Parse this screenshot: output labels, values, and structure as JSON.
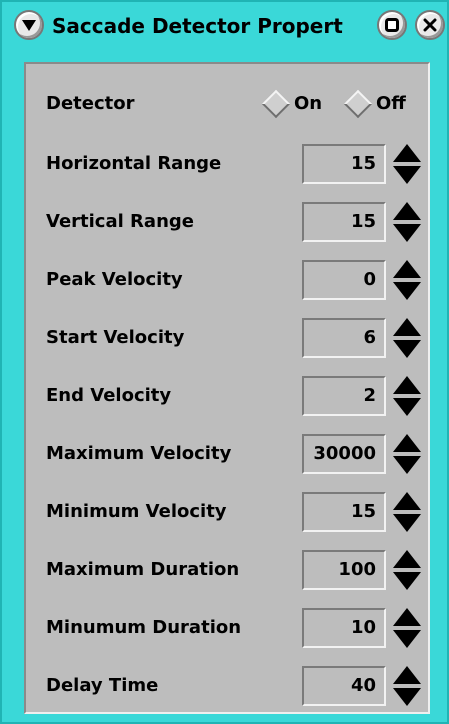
{
  "window": {
    "title": "Saccade Detector Propert"
  },
  "detector": {
    "label": "Detector",
    "options": [
      {
        "label": "On",
        "selected": false
      },
      {
        "label": "Off",
        "selected": false
      }
    ]
  },
  "fields": [
    {
      "label": "Horizontal Range",
      "value": "15"
    },
    {
      "label": "Vertical Range",
      "value": "15"
    },
    {
      "label": "Peak Velocity",
      "value": "0"
    },
    {
      "label": "Start Velocity",
      "value": "6"
    },
    {
      "label": "End Velocity",
      "value": "2"
    },
    {
      "label": "Maximum Velocity",
      "value": "30000"
    },
    {
      "label": "Minimum Velocity",
      "value": "15"
    },
    {
      "label": "Maximum Duration",
      "value": "100"
    },
    {
      "label": "Minumum Duration",
      "value": "10"
    },
    {
      "label": "Delay Time",
      "value": "40"
    }
  ],
  "icons": {
    "menu": "menu-icon",
    "maximize": "maximize-icon",
    "close": "close-icon",
    "spin_up": "arrow-up-icon",
    "spin_down": "arrow-down-icon"
  },
  "colors": {
    "frame": "#3ad8d8",
    "panel": "#bdbdbd"
  }
}
